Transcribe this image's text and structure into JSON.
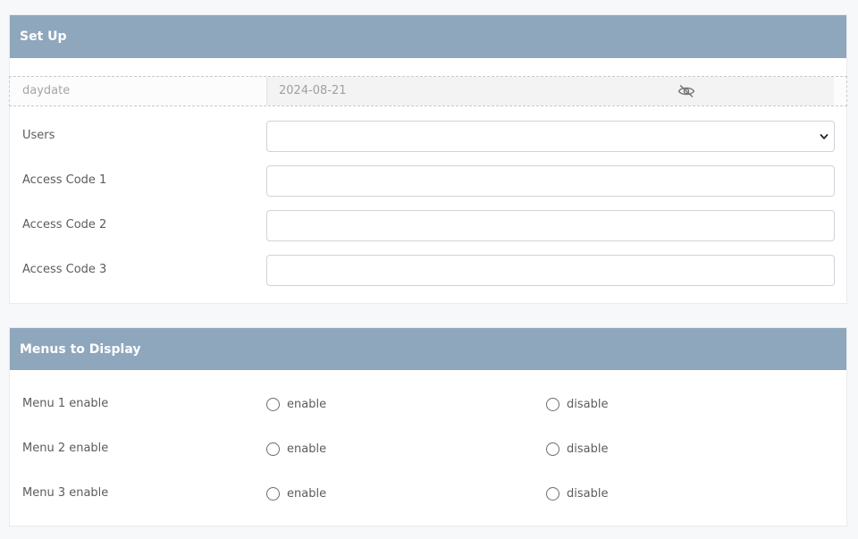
{
  "setup": {
    "title": "Set Up",
    "daydate": {
      "label": "daydate",
      "value": "2024-08-21"
    },
    "users": {
      "label": "Users",
      "value": ""
    },
    "access_codes": [
      {
        "label": "Access Code 1",
        "value": ""
      },
      {
        "label": "Access Code 2",
        "value": ""
      },
      {
        "label": "Access Code 3",
        "value": ""
      }
    ]
  },
  "menus": {
    "title": "Menus to Display",
    "items": [
      {
        "label": "Menu 1 enable",
        "enable_label": "enable",
        "disable_label": "disable"
      },
      {
        "label": "Menu 2 enable",
        "enable_label": "enable",
        "disable_label": "disable"
      },
      {
        "label": "Menu 3 enable",
        "enable_label": "enable",
        "disable_label": "disable"
      }
    ]
  },
  "icons": {
    "hidden": "eye-slash-icon",
    "dropdown": "chevron-down-icon"
  },
  "colors": {
    "header": "#8fa7bd",
    "background": "#f7f8fa"
  }
}
